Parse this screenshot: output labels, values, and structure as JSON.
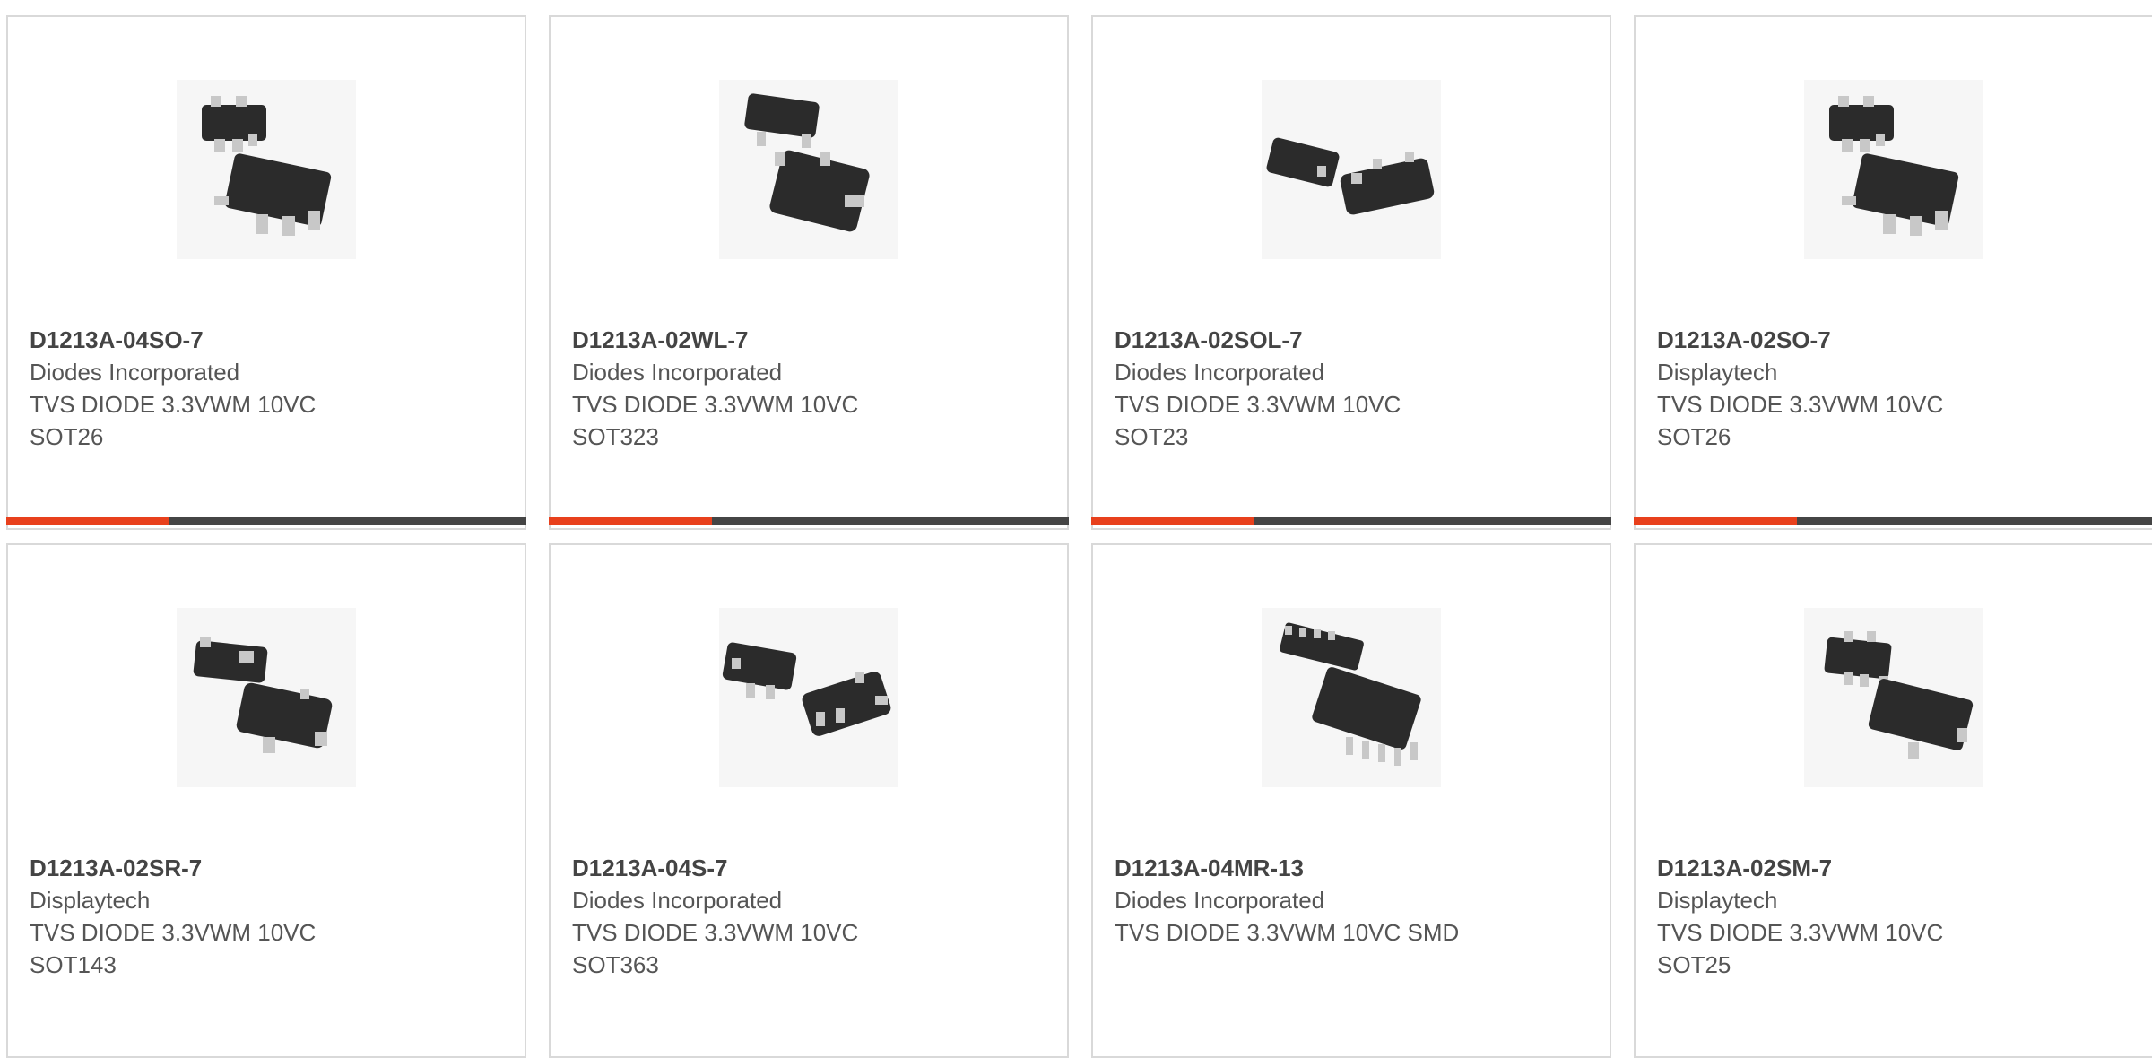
{
  "theme": {
    "accent": "#e8401c",
    "bar_dark": "#454545",
    "border": "#d9d9d9"
  },
  "products": [
    {
      "part_number": "D1213A-04SO-7",
      "manufacturer": "Diodes Incorporated",
      "description_line1": "TVS DIODE 3.3VWM 10VC",
      "description_line2": "SOT26",
      "image_icon": "sot26-package-icon"
    },
    {
      "part_number": "D1213A-02WL-7",
      "manufacturer": "Diodes Incorporated",
      "description_line1": "TVS DIODE 3.3VWM 10VC",
      "description_line2": "SOT323",
      "image_icon": "sot323-package-icon"
    },
    {
      "part_number": "D1213A-02SOL-7",
      "manufacturer": "Diodes Incorporated",
      "description_line1": "TVS DIODE 3.3VWM 10VC",
      "description_line2": "SOT23",
      "image_icon": "sot23-package-icon"
    },
    {
      "part_number": "D1213A-02SO-7",
      "manufacturer": "Displaytech",
      "description_line1": "TVS DIODE 3.3VWM 10VC",
      "description_line2": "SOT26",
      "image_icon": "sot26-package-icon"
    },
    {
      "part_number": "D1213A-02SR-7",
      "manufacturer": "Displaytech",
      "description_line1": "TVS DIODE 3.3VWM 10VC",
      "description_line2": "SOT143",
      "image_icon": "sot143-package-icon"
    },
    {
      "part_number": "D1213A-04S-7",
      "manufacturer": "Diodes Incorporated",
      "description_line1": "TVS DIODE 3.3VWM 10VC",
      "description_line2": "SOT363",
      "image_icon": "sot363-package-icon"
    },
    {
      "part_number": "D1213A-04MR-13",
      "manufacturer": "Diodes Incorporated",
      "description_line1": "TVS DIODE 3.3VWM 10VC SMD",
      "description_line2": "",
      "image_icon": "msop-package-icon"
    },
    {
      "part_number": "D1213A-02SM-7",
      "manufacturer": "Displaytech",
      "description_line1": "TVS DIODE 3.3VWM 10VC",
      "description_line2": "SOT25",
      "image_icon": "sot25-package-icon"
    }
  ]
}
